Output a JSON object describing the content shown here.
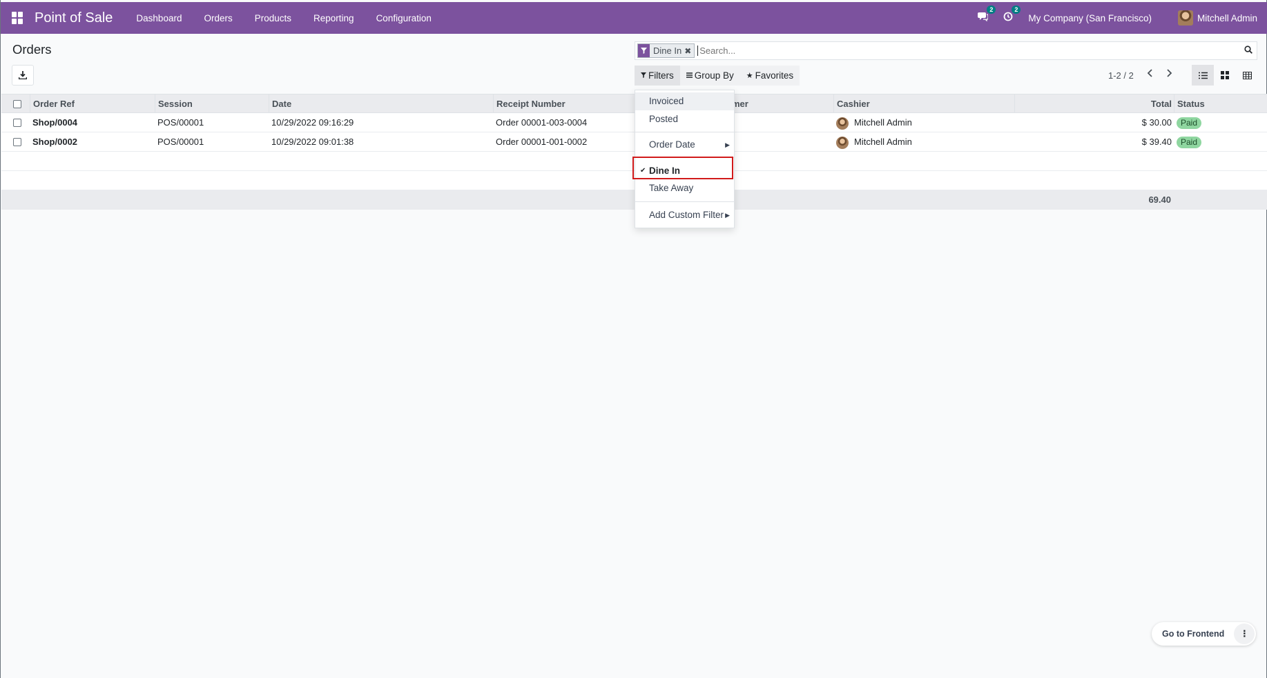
{
  "navbar": {
    "brand": "Point of Sale",
    "menu": [
      "Dashboard",
      "Orders",
      "Products",
      "Reporting",
      "Configuration"
    ],
    "messages_count": "2",
    "activities_count": "2",
    "company": "My Company (San Francisco)",
    "user": "Mitchell Admin",
    "bg_color": "#7c529e"
  },
  "page": {
    "title": "Orders"
  },
  "search": {
    "facet_label": "Dine In",
    "placeholder": "Search..."
  },
  "filter_buttons": {
    "filters": "Filters",
    "group_by": "Group By",
    "favorites": "Favorites"
  },
  "pager": {
    "value": "1-2 / 2"
  },
  "table": {
    "headers": {
      "order_ref": "Order Ref",
      "session": "Session",
      "date": "Date",
      "receipt_number": "Receipt Number",
      "customer": "mer",
      "cashier": "Cashier",
      "total": "Total",
      "status": "Status"
    },
    "rows": [
      {
        "order_ref": "Shop/0004",
        "session": "POS/00001",
        "date": "10/29/2022 09:16:29",
        "receipt_number": "Order 00001-003-0004",
        "cashier": "Mitchell Admin",
        "total": "$ 30.00",
        "status": "Paid"
      },
      {
        "order_ref": "Shop/0002",
        "session": "POS/00001",
        "date": "10/29/2022 09:01:38",
        "receipt_number": "Order 00001-001-0002",
        "cashier": "Mitchell Admin",
        "total": "$ 39.40",
        "status": "Paid"
      }
    ],
    "total_sum": "69.40"
  },
  "dropdown": {
    "invoiced": "Invoiced",
    "posted": "Posted",
    "order_date": "Order Date",
    "dine_in": "Dine In",
    "take_away": "Take Away",
    "add_custom_filter": "Add Custom Filter"
  },
  "footer": {
    "go_to_frontend": "Go to Frontend"
  },
  "icons": {
    "apps": "apps-grid-icon",
    "messages": "chat-icon",
    "activities": "clock-icon",
    "filter": "filter-funnel-icon",
    "search": "search-icon",
    "download": "download-icon",
    "list_view": "list-view-icon",
    "kanban_view": "kanban-view-icon",
    "pivot_view": "pivot-view-icon"
  }
}
